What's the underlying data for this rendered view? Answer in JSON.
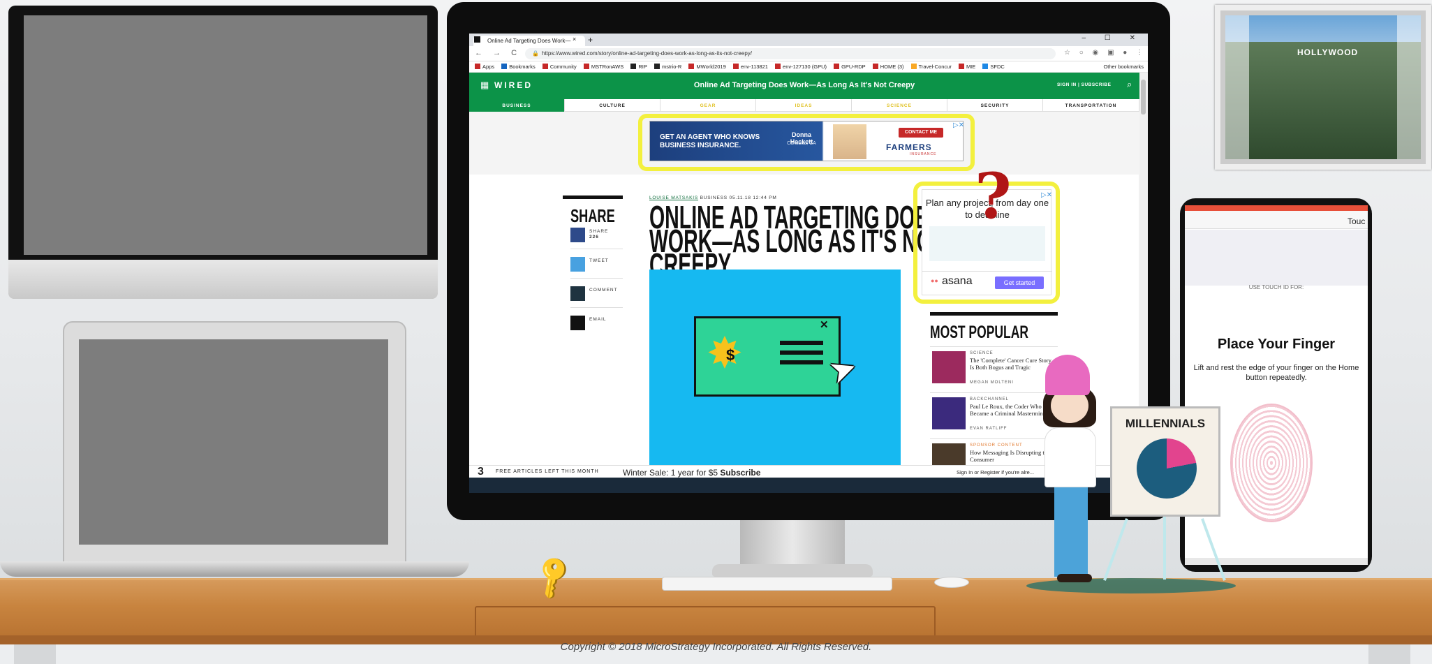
{
  "copyright": "Copyright © 2018 MicroStrategy Incorporated. All Rights Reserved.",
  "browser": {
    "tab_title": "Online Ad Targeting Does Work—",
    "new_tab": "+",
    "tab_close": "×",
    "window_controls": "– ☐ ✕",
    "nav_icons": "← → C ⌂",
    "url": "https://www.wired.com/story/online-ad-targeting-does-work-as-long-as-its-not-creepy/",
    "bookmarks": [
      "Apps",
      "Bookmarks",
      "Community",
      "MSTRonAWS",
      "RIP",
      "mstrio-R",
      "MWorld2019",
      "env-113821",
      "env-127130 (GPU)",
      "GPU-RDP",
      "HOME (3)",
      "Travel-Concur",
      "MIE",
      "SFDC"
    ],
    "other_bookmarks": "Other bookmarks"
  },
  "wired": {
    "logo": "WIRED",
    "grid_icon": "▦",
    "page_title": "Online Ad Targeting Does Work—As Long As It's Not Creepy",
    "sign_in": "SIGN IN | SUBSCRIBE",
    "search_icon": "⌕",
    "nav": [
      "BUSINESS",
      "CULTURE",
      "GEAR",
      "IDEAS",
      "SCIENCE",
      "SECURITY",
      "TRANSPORTATION"
    ],
    "ad_banner": {
      "text": "GET AN AGENT WHO KNOWS BUSINESS INSURANCE.",
      "agent": "Donna Hackett",
      "location": "Carlsbad, CA",
      "contact": "CONTACT ME",
      "brand": "FARMERS",
      "brand_sub": "INSURANCE",
      "close": "▷✕"
    },
    "share": {
      "title": "SHARE",
      "items": [
        {
          "label": "SHARE",
          "count": "226",
          "icon": "f"
        },
        {
          "label": "TWEET",
          "count": "",
          "icon": "t"
        },
        {
          "label": "COMMENT",
          "count": "",
          "icon": "c"
        },
        {
          "label": "EMAIL",
          "count": "",
          "icon": "e"
        }
      ]
    },
    "article": {
      "author": "LOUISE MATSAKIS",
      "section": "BUSINESS",
      "date": "05.11.18 12:44 PM",
      "headline": "ONLINE AD TARGETING DOES WORK—AS LONG AS IT'S NOT CREEPY"
    },
    "asana_ad": {
      "text": "Plan any project, from day one to deadline",
      "brand": "asana",
      "cta": "Get started",
      "close": "▷✕"
    },
    "most_popular": {
      "title": "MOST POPULAR",
      "items": [
        {
          "category": "SCIENCE",
          "title": "The 'Complete' Cancer Cure Story Is Both Bogus and Tragic",
          "author": "MEGAN MOLTENI",
          "color": "#9c2a5e"
        },
        {
          "category": "BACKCHANNEL",
          "title": "Paul Le Roux, the Coder Who Became a Criminal Mastermind",
          "author": "EVAN RATLIFF",
          "color": "#3b2a7d"
        },
        {
          "category": "SPONSOR CONTENT",
          "title": "How Messaging Is Disrupting the Consumer",
          "author": "",
          "color": "#4a3a2a"
        }
      ]
    },
    "paywall": {
      "count": "3",
      "text": "FREE ARTICLES LEFT THIS MONTH",
      "sale": "Winter Sale: 1 year for $5",
      "subscribe": "Subscribe",
      "signin": "Sign In or Register if you're alre..."
    }
  },
  "question_mark": "?",
  "phone": {
    "top_label": "Touc",
    "section": "USE TOUCH ID FOR:",
    "title": "Place Your Finger",
    "instruction": "Lift and rest the edge of your finger on the Home button repeatedly."
  },
  "board_label": "MILLENNIALS",
  "hollywood_sign": "HOLLYWOOD",
  "colors": {
    "wired_green": "#0c9348",
    "highlight_yellow": "#f3f03e",
    "asana_purple": "#796eff",
    "farmers_red": "#c62828"
  }
}
